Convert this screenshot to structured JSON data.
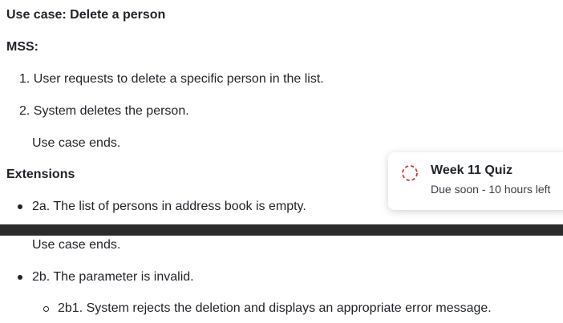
{
  "doc": {
    "use_case_title": "Use case: Delete a person",
    "mss_heading": "MSS:",
    "steps": [
      "1. User requests to delete a specific person in the list.",
      "2. System deletes the person."
    ],
    "use_case_ends_1": "Use case ends.",
    "extensions_heading": "Extensions",
    "ext_2a": "2a. The list of persons in address book is empty.",
    "use_case_ends_2": "Use case ends.",
    "ext_2b": "2b. The parameter is invalid.",
    "ext_2b1": "2b1. System rejects the deletion and displays an appropriate error message."
  },
  "notification": {
    "title": "Week 11 Quiz",
    "subtitle": "Due soon - 10 hours left",
    "icon": "dashed-circle-icon",
    "icon_color": "#e0302e"
  },
  "colors": {
    "text": "#1f2328",
    "dark_bar": "#2b2b2b"
  }
}
